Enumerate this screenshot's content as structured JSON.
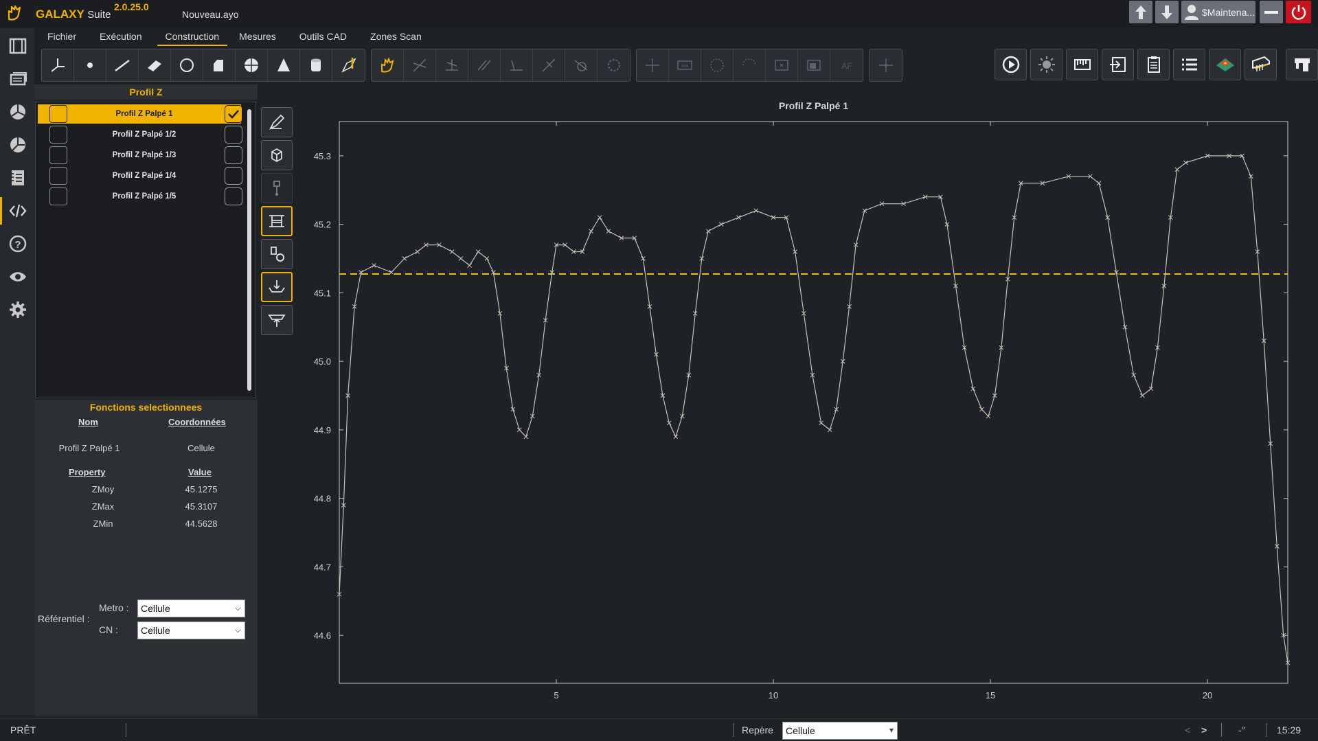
{
  "app": {
    "brand": "GALAXY",
    "suite": "Suite",
    "version": "2.0.25.0",
    "filename": "Nouveau.ayo",
    "user": "$Maintena..."
  },
  "menu": [
    "Fichier",
    "Exécution",
    "Construction",
    "Mesures",
    "Outils CAD",
    "Zones Scan"
  ],
  "menu_active": "Construction",
  "panel": {
    "title": "Profil Z",
    "items": [
      {
        "label": "Profil Z Palpé 1",
        "selected": true,
        "checked": true
      },
      {
        "label": "Profil Z Palpé 1/2",
        "selected": false,
        "checked": false
      },
      {
        "label": "Profil Z Palpé 1/3",
        "selected": false,
        "checked": false
      },
      {
        "label": "Profil Z Palpé 1/4",
        "selected": false,
        "checked": false
      },
      {
        "label": "Profil Z Palpé 1/5",
        "selected": false,
        "checked": false
      }
    ]
  },
  "functions": {
    "title": "Fonctions selectionnees",
    "col_nom": "Nom",
    "col_coord": "Coordonnées",
    "row_nom": "Profil Z Palpé 1",
    "row_coord": "Cellule",
    "col_property": "Property",
    "col_value": "Value",
    "props": [
      {
        "name": "ZMoy",
        "value": "45.1275"
      },
      {
        "name": "ZMax",
        "value": "45.3107"
      },
      {
        "name": "ZMin",
        "value": "44.5628"
      }
    ]
  },
  "referentiel": {
    "label": "Référentiel :",
    "metro_label": "Metro :",
    "metro_value": "Cellule",
    "cn_label": "CN :",
    "cn_value": "Cellule"
  },
  "status": {
    "ready": "PRÊT",
    "repere_label": "Repère",
    "repere_value": "Cellule",
    "nav_prev": "<",
    "nav_next": ">",
    "angle": "-°",
    "time": "15:29"
  },
  "colors": {
    "accent": "#f0b400",
    "background": "#1e2125",
    "mean_line": "#f0c000",
    "trace": "#c9c2b6"
  },
  "chart_data": {
    "type": "line",
    "title": "Profil Z Palpé 1",
    "xlabel": "",
    "ylabel": "",
    "xlim": [
      0,
      21.85
    ],
    "ylim": [
      44.53,
      45.35
    ],
    "xticks": [
      5,
      10,
      15,
      20
    ],
    "yticks": [
      44.6,
      44.7,
      44.8,
      44.9,
      45.0,
      45.1,
      45.2,
      45.3
    ],
    "mean_line": 45.1275,
    "grid": false,
    "marker": "x",
    "series": [
      {
        "name": "",
        "points": [
          [
            0.0,
            44.66
          ],
          [
            0.1,
            44.79
          ],
          [
            0.2,
            44.95
          ],
          [
            0.35,
            45.08
          ],
          [
            0.5,
            45.13
          ],
          [
            0.8,
            45.14
          ],
          [
            1.2,
            45.13
          ],
          [
            1.5,
            45.15
          ],
          [
            1.8,
            45.16
          ],
          [
            2.0,
            45.17
          ],
          [
            2.3,
            45.17
          ],
          [
            2.6,
            45.16
          ],
          [
            2.8,
            45.15
          ],
          [
            3.0,
            45.14
          ],
          [
            3.2,
            45.16
          ],
          [
            3.4,
            45.15
          ],
          [
            3.55,
            45.13
          ],
          [
            3.7,
            45.07
          ],
          [
            3.85,
            44.99
          ],
          [
            4.0,
            44.93
          ],
          [
            4.15,
            44.9
          ],
          [
            4.3,
            44.89
          ],
          [
            4.45,
            44.92
          ],
          [
            4.6,
            44.98
          ],
          [
            4.75,
            45.06
          ],
          [
            4.9,
            45.13
          ],
          [
            5.0,
            45.17
          ],
          [
            5.2,
            45.17
          ],
          [
            5.4,
            45.16
          ],
          [
            5.6,
            45.16
          ],
          [
            5.8,
            45.19
          ],
          [
            6.0,
            45.21
          ],
          [
            6.2,
            45.19
          ],
          [
            6.5,
            45.18
          ],
          [
            6.8,
            45.18
          ],
          [
            7.0,
            45.15
          ],
          [
            7.15,
            45.08
          ],
          [
            7.3,
            45.01
          ],
          [
            7.45,
            44.95
          ],
          [
            7.6,
            44.91
          ],
          [
            7.75,
            44.89
          ],
          [
            7.9,
            44.92
          ],
          [
            8.05,
            44.98
          ],
          [
            8.2,
            45.07
          ],
          [
            8.35,
            45.15
          ],
          [
            8.5,
            45.19
          ],
          [
            8.8,
            45.2
          ],
          [
            9.2,
            45.21
          ],
          [
            9.6,
            45.22
          ],
          [
            10.0,
            45.21
          ],
          [
            10.3,
            45.21
          ],
          [
            10.5,
            45.16
          ],
          [
            10.7,
            45.07
          ],
          [
            10.9,
            44.98
          ],
          [
            11.1,
            44.91
          ],
          [
            11.3,
            44.9
          ],
          [
            11.45,
            44.93
          ],
          [
            11.6,
            45.0
          ],
          [
            11.75,
            45.08
          ],
          [
            11.9,
            45.17
          ],
          [
            12.1,
            45.22
          ],
          [
            12.5,
            45.23
          ],
          [
            13.0,
            45.23
          ],
          [
            13.5,
            45.24
          ],
          [
            13.85,
            45.24
          ],
          [
            14.0,
            45.2
          ],
          [
            14.2,
            45.11
          ],
          [
            14.4,
            45.02
          ],
          [
            14.6,
            44.96
          ],
          [
            14.8,
            44.93
          ],
          [
            14.95,
            44.92
          ],
          [
            15.1,
            44.95
          ],
          [
            15.25,
            45.02
          ],
          [
            15.4,
            45.12
          ],
          [
            15.55,
            45.21
          ],
          [
            15.7,
            45.26
          ],
          [
            16.2,
            45.26
          ],
          [
            16.8,
            45.27
          ],
          [
            17.3,
            45.27
          ],
          [
            17.5,
            45.26
          ],
          [
            17.7,
            45.21
          ],
          [
            17.9,
            45.13
          ],
          [
            18.1,
            45.05
          ],
          [
            18.3,
            44.98
          ],
          [
            18.5,
            44.95
          ],
          [
            18.7,
            44.96
          ],
          [
            18.85,
            45.02
          ],
          [
            19.0,
            45.11
          ],
          [
            19.15,
            45.21
          ],
          [
            19.3,
            45.28
          ],
          [
            19.5,
            45.29
          ],
          [
            20.0,
            45.3
          ],
          [
            20.5,
            45.3
          ],
          [
            20.8,
            45.3
          ],
          [
            21.0,
            45.27
          ],
          [
            21.15,
            45.16
          ],
          [
            21.3,
            45.03
          ],
          [
            21.45,
            44.88
          ],
          [
            21.6,
            44.73
          ],
          [
            21.75,
            44.6
          ],
          [
            21.85,
            44.56
          ]
        ]
      }
    ]
  }
}
